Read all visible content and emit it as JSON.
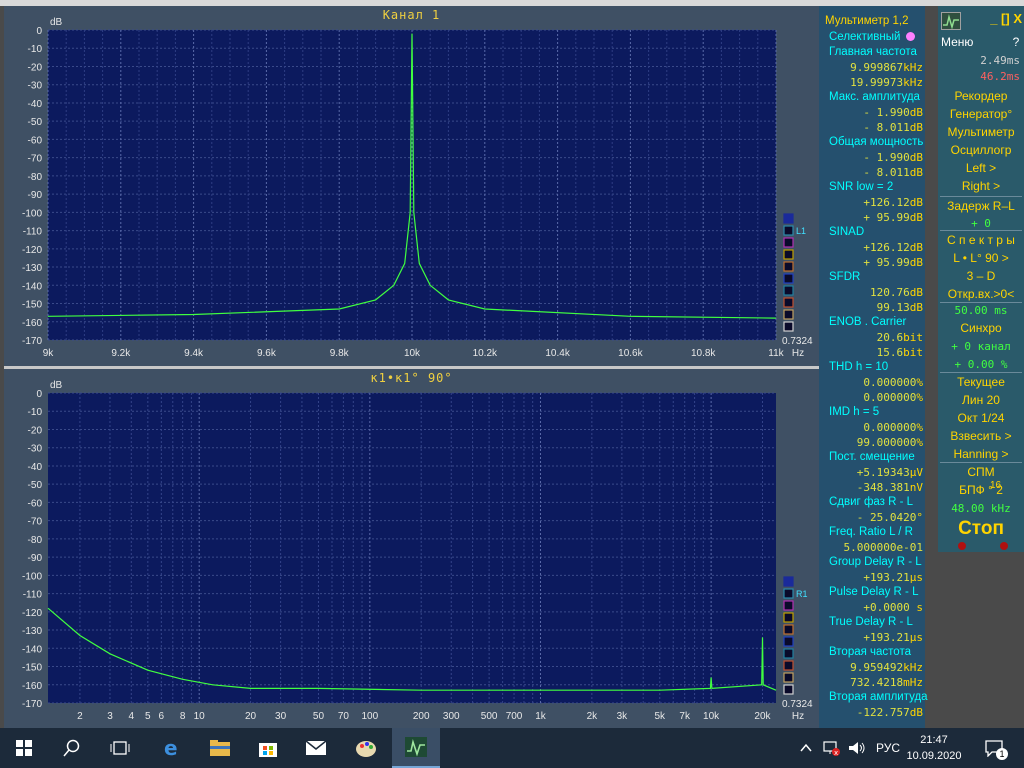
{
  "charts": [
    {
      "title": "Канал 1",
      "ylabel": "dB",
      "yticks": [
        "0",
        "-10",
        "-20",
        "-30",
        "-40",
        "-50",
        "-60",
        "-70",
        "-80",
        "-90",
        "-100",
        "-110",
        "-120",
        "-130",
        "-140",
        "-150",
        "-160",
        "-170"
      ],
      "xticks": [
        "9k",
        "9.2k",
        "9.4k",
        "9.6k",
        "9.8k",
        "10k",
        "10.2k",
        "10.4k",
        "10.6k",
        "10.8k",
        "11k"
      ],
      "xunit": "Hz",
      "scale_value": "0.7324",
      "channel_tag": "L1",
      "chart_data": {
        "type": "line",
        "title": "Канал 1",
        "xlabel": "Hz",
        "ylabel": "dB",
        "xscale": "linear",
        "xlim": [
          9000,
          11000
        ],
        "ylim": [
          -170,
          0
        ],
        "grid": true,
        "series": [
          {
            "name": "",
            "color": "#40ff40",
            "x": [
              9000,
              9400,
              9800,
              9900,
              9950,
              9980,
              9995,
              10000,
              10005,
              10020,
              10050,
              10100,
              10200,
              10600,
              11000
            ],
            "y": [
              -157,
              -156,
              -153,
              -148,
              -140,
              -128,
              -100,
              -2,
              -100,
              -128,
              -140,
              -148,
              -153,
              -157,
              -158
            ]
          }
        ]
      }
    },
    {
      "title": "к1•к1° 90°",
      "ylabel": "dB",
      "yticks": [
        "0",
        "-10",
        "-20",
        "-30",
        "-40",
        "-50",
        "-60",
        "-70",
        "-80",
        "-90",
        "-100",
        "-110",
        "-120",
        "-130",
        "-140",
        "-150",
        "-160",
        "-170"
      ],
      "xticks": [
        "2",
        "3",
        "4",
        "5",
        "6",
        "8",
        "10",
        "20",
        "30",
        "50",
        "70",
        "100",
        "200",
        "300",
        "500",
        "700",
        "1k",
        "2k",
        "3k",
        "5k",
        "7k",
        "10k",
        "20k"
      ],
      "xunit": "Hz",
      "scale_value": "0.7324",
      "channel_tag": "R1",
      "chart_data": {
        "type": "line",
        "title": "к1•к1° 90°",
        "xlabel": "Hz",
        "ylabel": "dB",
        "xscale": "log",
        "xlim": [
          1.3,
          24000
        ],
        "ylim": [
          -170,
          0
        ],
        "grid": true,
        "series": [
          {
            "name": "",
            "color": "#40ff40",
            "x": [
              1.3,
              2,
              3,
              5,
              8,
              12,
              20,
              50,
              200,
              1000,
              5000,
              9900,
              10000,
              10100,
              19800,
              20000,
              20200,
              24000
            ],
            "y": [
              -118,
              -133,
              -143,
              -152,
              -157,
              -160,
              -162,
              -162,
              -163,
              -163,
              -163,
              -162,
              -156,
              -162,
              -160,
              -134,
              -160,
              -163
            ]
          }
        ]
      }
    }
  ],
  "multimeter": {
    "header": "Мультиметр 1,2",
    "rows": [
      {
        "t": "lbl",
        "v": "Селективный"
      },
      {
        "t": "lbl",
        "v": "Главная частота"
      },
      {
        "t": "val",
        "v": "9.999867",
        "u": "kHz"
      },
      {
        "t": "val",
        "v": "19.99973",
        "u": "kHz"
      },
      {
        "t": "lbl",
        "v": "Макс. амплитуда"
      },
      {
        "t": "val",
        "v": "-  1.990",
        "u": "dB"
      },
      {
        "t": "val",
        "v": "-  8.011",
        "u": "dB"
      },
      {
        "t": "lbl",
        "v": "Общая мощность"
      },
      {
        "t": "val",
        "v": "-  1.990",
        "u": "dB"
      },
      {
        "t": "val",
        "v": "-  8.011",
        "u": "dB"
      },
      {
        "t": "lbl",
        "v": "SNR     low =  2"
      },
      {
        "t": "val",
        "v": "+126.12",
        "u": "dB"
      },
      {
        "t": "val",
        "v": "+ 95.99",
        "u": "dB"
      },
      {
        "t": "lbl",
        "v": "SINAD"
      },
      {
        "t": "val",
        "v": "+126.12",
        "u": "dB"
      },
      {
        "t": "val",
        "v": "+ 95.99",
        "u": "dB"
      },
      {
        "t": "lbl",
        "v": "SFDR"
      },
      {
        "t": "val",
        "v": "120.76",
        "u": "dB"
      },
      {
        "t": "val",
        "v": "99.13",
        "u": "dB"
      },
      {
        "t": "lbl",
        "v": "ENOB . Carrier"
      },
      {
        "t": "val",
        "v": "20.6",
        "u": "bit"
      },
      {
        "t": "val",
        "v": "15.6",
        "u": "bit"
      },
      {
        "t": "lbl",
        "v": "THD     h = 10"
      },
      {
        "t": "val",
        "v": "0.000000",
        "u": "%"
      },
      {
        "t": "val",
        "v": "0.000000",
        "u": "%"
      },
      {
        "t": "lbl",
        "v": "IMD      h =  5"
      },
      {
        "t": "val",
        "v": "0.000000",
        "u": "%"
      },
      {
        "t": "val",
        "v": "99.000000",
        "u": "%"
      },
      {
        "t": "lbl",
        "v": "Пост. смещение"
      },
      {
        "t": "val",
        "v": "+5.19343",
        "u": "µV"
      },
      {
        "t": "val",
        "v": "-348.381",
        "u": "nV"
      },
      {
        "t": "lbl",
        "v": "Сдвиг фаз R - L"
      },
      {
        "t": "val",
        "v": "- 25.0420",
        "u": "°"
      },
      {
        "t": "lbl",
        "v": "Freq. Ratio  L / R"
      },
      {
        "t": "val",
        "v": "5.000000e-01",
        "u": ""
      },
      {
        "t": "lbl",
        "v": "Group Delay R - L"
      },
      {
        "t": "val",
        "v": "+193.21",
        "u": "µs"
      },
      {
        "t": "lbl",
        "v": "Pulse Delay R - L"
      },
      {
        "t": "val",
        "v": "+0.0000",
        "u": " s"
      },
      {
        "t": "lbl",
        "v": "True Delay R - L"
      },
      {
        "t": "val",
        "v": "+193.21",
        "u": "µs"
      },
      {
        "t": "lbl",
        "v": "Вторая частота"
      },
      {
        "t": "val",
        "v": "9.959492",
        "u": "kHz"
      },
      {
        "t": "val",
        "v": "732.4218",
        "u": "mHz"
      },
      {
        "t": "lbl",
        "v": "Вторая амплитуда"
      },
      {
        "t": "val",
        "v": "-122.757",
        "u": "dB"
      }
    ]
  },
  "control": {
    "close_label": "_ [] X",
    "menu_label": "Меню",
    "help_label": "?",
    "time1": "2.49ms",
    "time2": "46.2ms",
    "items": [
      {
        "t": "y",
        "v": "Рекордер"
      },
      {
        "t": "y",
        "v": "Генератор°"
      },
      {
        "t": "y",
        "v": "Мультиметр"
      },
      {
        "t": "y",
        "v": "Осциллогр"
      },
      {
        "t": "y",
        "v": "Left     >"
      },
      {
        "t": "y",
        "v": "Right    >"
      },
      {
        "t": "y",
        "v": "Задерж  R–L"
      },
      {
        "t": "g",
        "v": "+       0"
      },
      {
        "t": "y",
        "v": "С п е к т р ы"
      },
      {
        "t": "y",
        "v": "L • L° 90  >"
      },
      {
        "t": "y",
        "v": "3 – D"
      },
      {
        "t": "y",
        "v": "Откр.вх.>0<"
      },
      {
        "t": "g",
        "v": "50.00 ms"
      },
      {
        "t": "y",
        "v": "Синхро"
      },
      {
        "t": "g",
        "v": "+ 0 канал"
      },
      {
        "t": "g",
        "v": "+ 0.00 %"
      },
      {
        "t": "y",
        "v": "Текущее"
      },
      {
        "t": "y",
        "v": "Лин      20"
      },
      {
        "t": "y",
        "v": "Окт  1/24"
      },
      {
        "t": "y",
        "v": "Взвесить  >"
      },
      {
        "t": "y",
        "v": "Hanning   >"
      },
      {
        "t": "y",
        "v": "СПМ"
      },
      {
        "t": "y",
        "v": "БПФ ° 2"
      },
      {
        "t": "g",
        "v": "48.00 kHz"
      }
    ],
    "fft_exp": "16",
    "stop_label": "Стоп"
  },
  "taskbar": {
    "lang": "РУС",
    "time": "21:47",
    "date": "10.09.2020",
    "notif_count": "1"
  }
}
